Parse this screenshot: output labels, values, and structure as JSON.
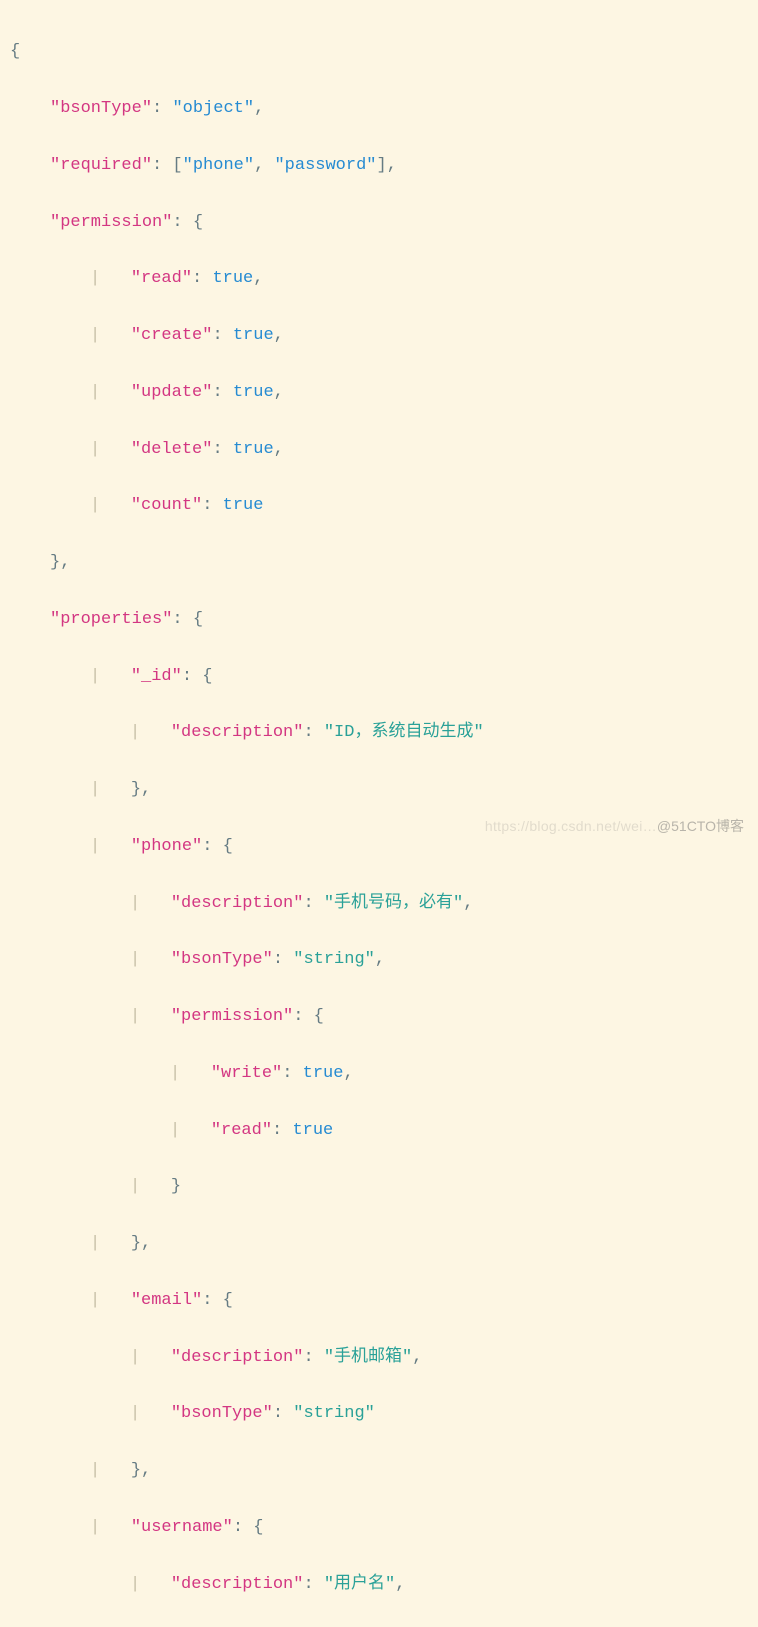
{
  "line1": {
    "open": "{"
  },
  "line2": {
    "k": "\"bsonType\"",
    "c": ": ",
    "v": "\"object\"",
    "e": ","
  },
  "line3": {
    "k": "\"required\"",
    "c": ": [",
    "v1": "\"phone\"",
    "sep": ", ",
    "v2": "\"password\"",
    "e": "],"
  },
  "line4": {
    "k": "\"permission\"",
    "c": ": {"
  },
  "line5": {
    "k": "\"read\"",
    "c": ": ",
    "v": "true",
    "e": ","
  },
  "line6": {
    "k": "\"create\"",
    "c": ": ",
    "v": "true",
    "e": ","
  },
  "line7": {
    "k": "\"update\"",
    "c": ": ",
    "v": "true",
    "e": ","
  },
  "line8": {
    "k": "\"delete\"",
    "c": ": ",
    "v": "true",
    "e": ","
  },
  "line9": {
    "k": "\"count\"",
    "c": ": ",
    "v": "true"
  },
  "line10": {
    "close": "},"
  },
  "line11": {
    "k": "\"properties\"",
    "c": ": {"
  },
  "line12": {
    "k": "\"_id\"",
    "c": ": {"
  },
  "line13": {
    "k": "\"description\"",
    "c": ": ",
    "v": "\"ID，系统自动生成\""
  },
  "line14": {
    "close": "},"
  },
  "line15": {
    "k": "\"phone\"",
    "c": ": {"
  },
  "line16": {
    "k": "\"description\"",
    "c": ": ",
    "v": "\"手机号码，必有\"",
    "e": ","
  },
  "line17": {
    "k": "\"bsonType\"",
    "c": ": ",
    "v": "\"string\"",
    "e": ","
  },
  "line18": {
    "k": "\"permission\"",
    "c": ": {"
  },
  "line19": {
    "k": "\"write\"",
    "c": ": ",
    "v": "true",
    "e": ","
  },
  "line20": {
    "k": "\"read\"",
    "c": ": ",
    "v": "true"
  },
  "line21": {
    "close": "}"
  },
  "line22": {
    "close": "},"
  },
  "line23": {
    "k": "\"email\"",
    "c": ": {"
  },
  "line24": {
    "k": "\"description\"",
    "c": ": ",
    "v": "\"手机邮箱\"",
    "e": ","
  },
  "line25": {
    "k": "\"bsonType\"",
    "c": ": ",
    "v": "\"string\""
  },
  "line26": {
    "close": "},"
  },
  "line27": {
    "k": "\"username\"",
    "c": ": {"
  },
  "line28": {
    "k": "\"description\"",
    "c": ": ",
    "v": "\"用户名\"",
    "e": ","
  },
  "watermark": {
    "faint": "https://blog.csdn.net/wei…",
    "bold": "@51CTO博客"
  }
}
